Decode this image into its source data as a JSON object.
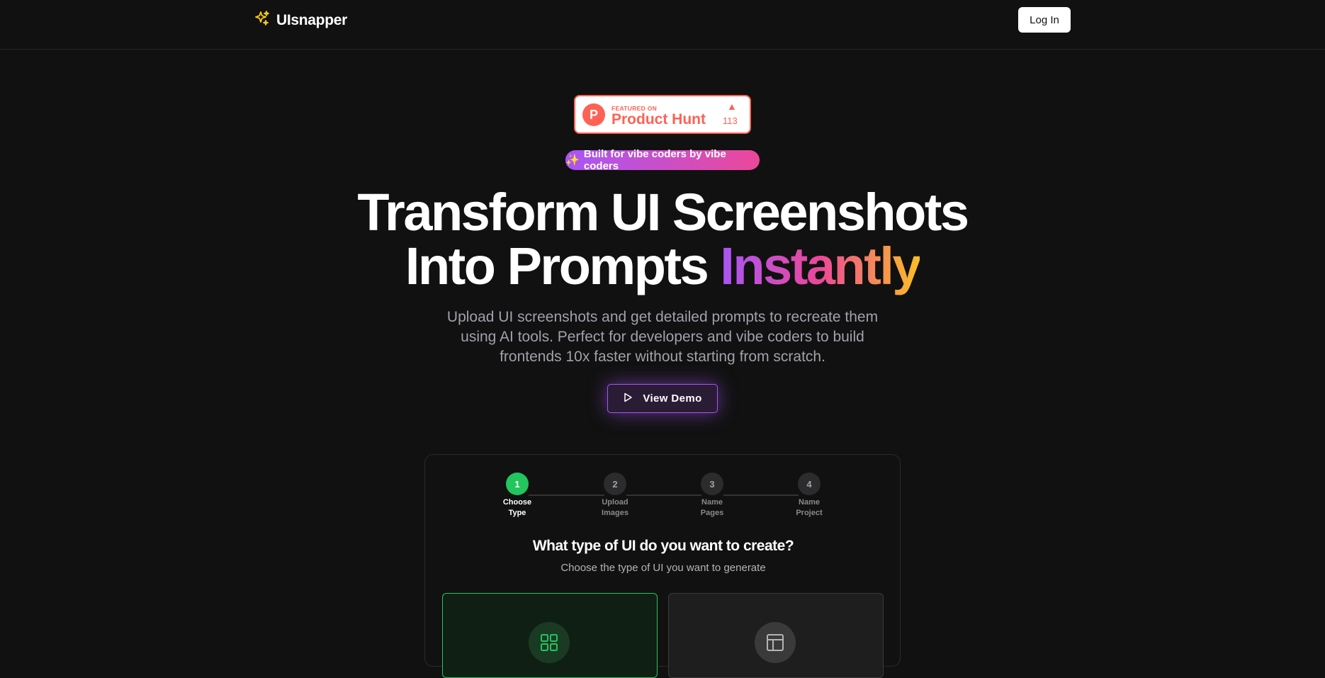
{
  "brand": {
    "name": "UIsnapper",
    "icon": "sparkles-icon",
    "accent": "#facc15"
  },
  "nav": {
    "login_label": "Log In"
  },
  "product_hunt": {
    "featured_label": "FEATURED ON",
    "name": "Product Hunt",
    "logo_letter": "P",
    "upvotes": "113",
    "color": "#ff6154"
  },
  "tagline": {
    "emoji": "✨",
    "text": "Built for vibe coders by vibe coders"
  },
  "hero": {
    "title_line1": "Transform UI Screenshots",
    "title_line2_plain": "Into Prompts ",
    "title_line2_gradient": "Instantly",
    "subtitle": "Upload UI screenshots and get detailed prompts to recreate them using AI tools. Perfect for developers and vibe coders to build frontends 10x faster without starting from scratch.",
    "demo_button": "View Demo"
  },
  "wizard": {
    "steps": [
      {
        "number": "1",
        "line1": "Choose",
        "line2": "Type",
        "active": true
      },
      {
        "number": "2",
        "line1": "Upload",
        "line2": "Images",
        "active": false
      },
      {
        "number": "3",
        "line1": "Name",
        "line2": "Pages",
        "active": false
      },
      {
        "number": "4",
        "line1": "Name",
        "line2": "Project",
        "active": false
      }
    ],
    "title": "What type of UI do you want to create?",
    "subtitle": "Choose the type of UI you want to generate",
    "options": [
      {
        "icon": "grid-icon",
        "selected": true
      },
      {
        "icon": "layout-icon",
        "selected": false
      }
    ]
  },
  "colors": {
    "background": "#111111",
    "success": "#22c55e",
    "gradient_start": "#a855f7",
    "gradient_mid": "#ec4899",
    "gradient_end": "#fbbf24"
  }
}
